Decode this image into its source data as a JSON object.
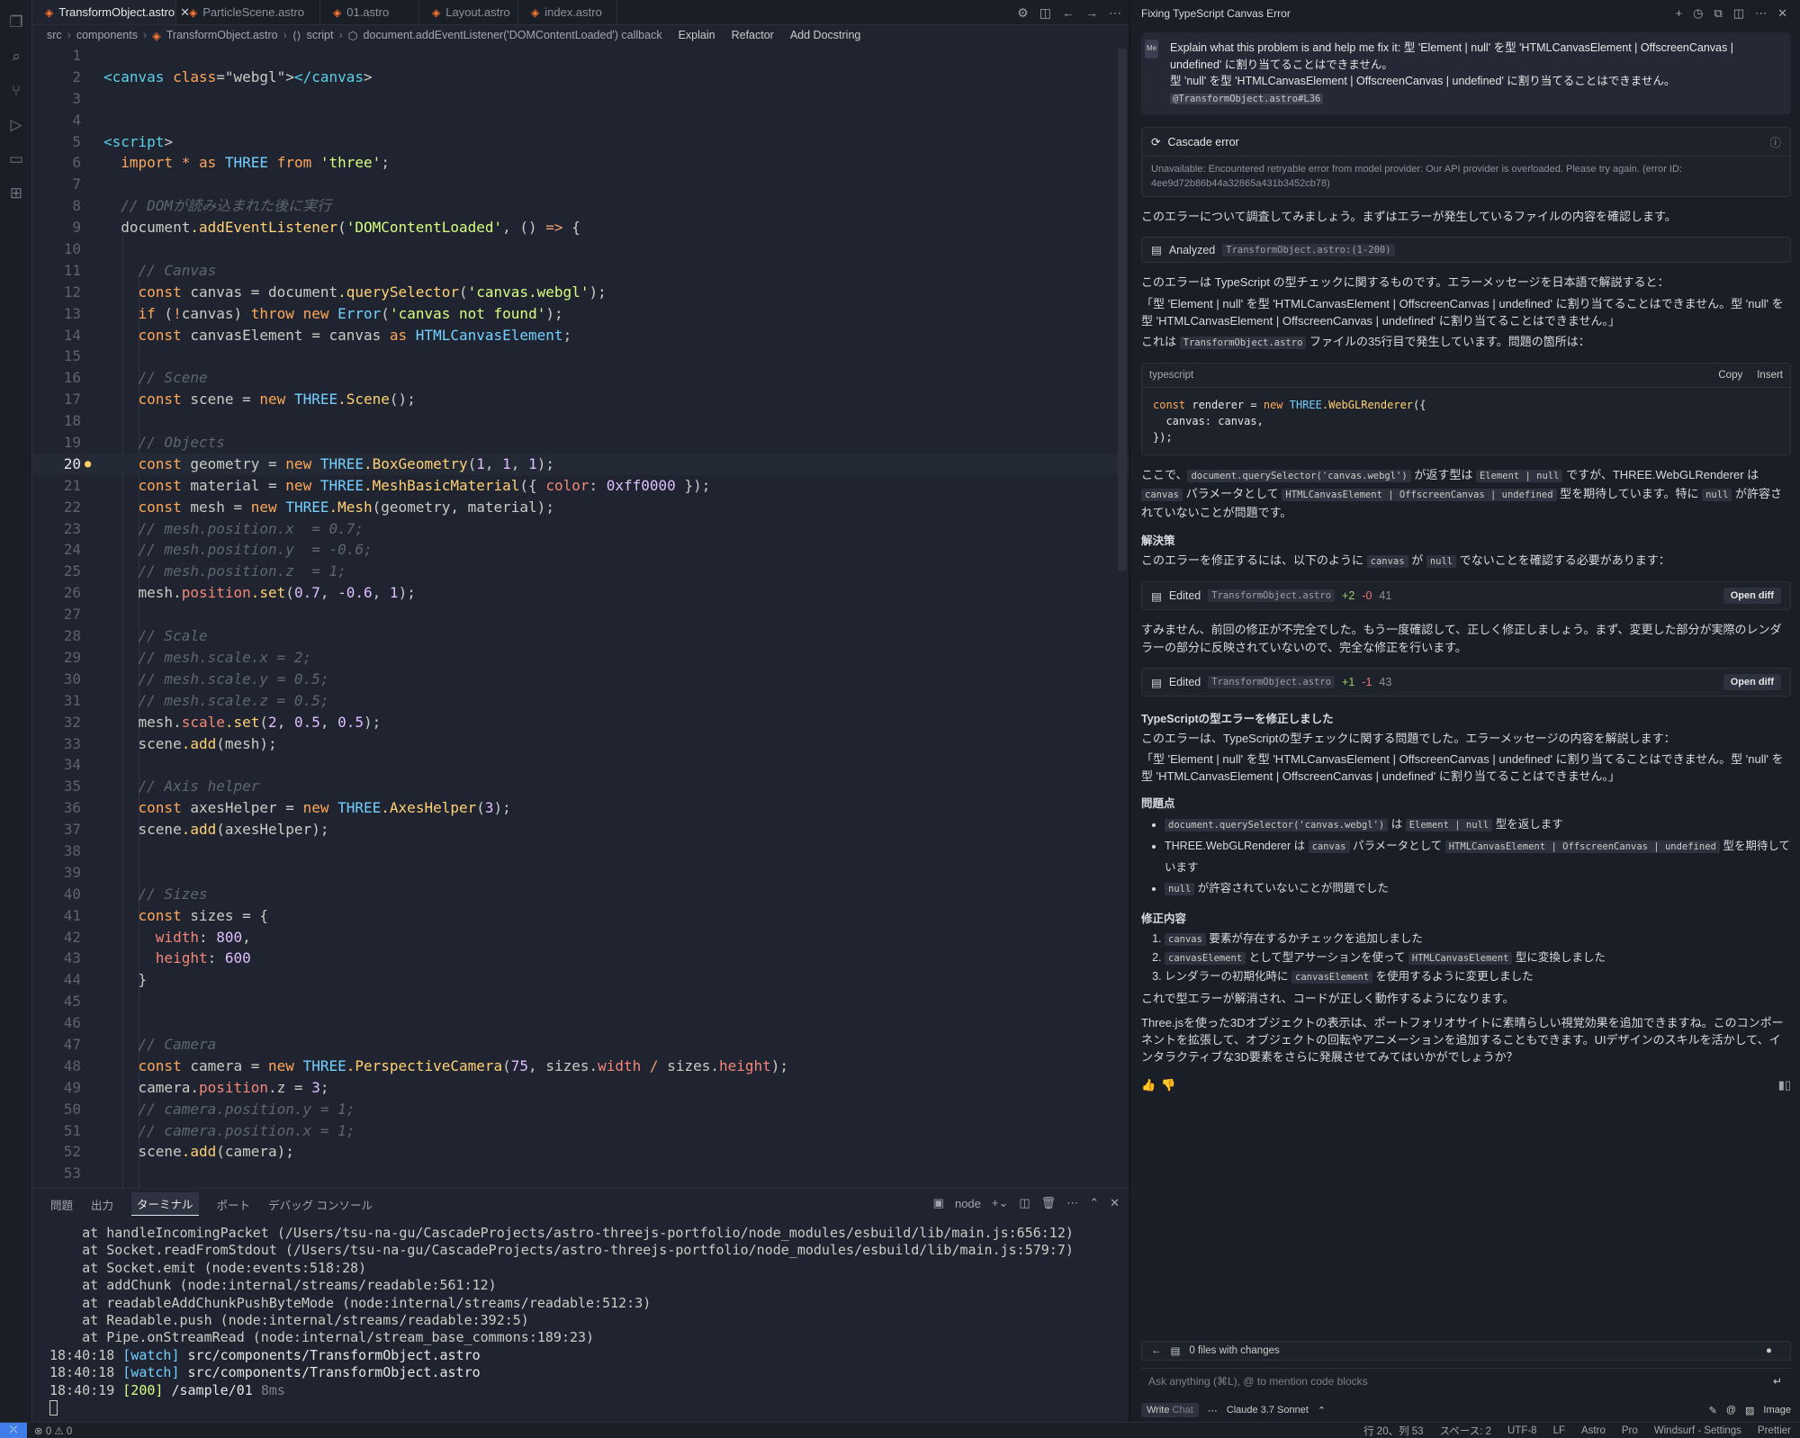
{
  "tabs": [
    {
      "label": "TransformObject.astro",
      "active": true
    },
    {
      "label": "ParticleScene.astro"
    },
    {
      "label": "01.astro"
    },
    {
      "label": "Layout.astro"
    },
    {
      "label": "index.astro"
    }
  ],
  "breadcrumb": [
    "src",
    "components",
    "TransformObject.astro",
    "script",
    "document.addEventListener('DOMContentLoaded') callback"
  ],
  "code_actions": [
    "Explain",
    "Refactor",
    "Add Docstring"
  ],
  "code_lines": [
    {
      "n": "1",
      "t": ""
    },
    {
      "n": "2",
      "t": "<canvas class=\"webgl\"></canvas>"
    },
    {
      "n": "3",
      "t": ""
    },
    {
      "n": "4",
      "t": ""
    },
    {
      "n": "5",
      "t": "<script>"
    },
    {
      "n": "6",
      "t": "  import * as THREE from 'three';"
    },
    {
      "n": "7",
      "t": ""
    },
    {
      "n": "8",
      "t": "  // DOMが読み込まれた後に実行"
    },
    {
      "n": "9",
      "t": "  document.addEventListener('DOMContentLoaded', () => {"
    },
    {
      "n": "10",
      "t": ""
    },
    {
      "n": "11",
      "t": "    // Canvas"
    },
    {
      "n": "12",
      "t": "    const canvas = document.querySelector('canvas.webgl');"
    },
    {
      "n": "13",
      "t": "    if (!canvas) throw new Error('canvas not found');"
    },
    {
      "n": "14",
      "t": "    const canvasElement = canvas as HTMLCanvasElement;"
    },
    {
      "n": "15",
      "t": ""
    },
    {
      "n": "16",
      "t": "    // Scene"
    },
    {
      "n": "17",
      "t": "    const scene = new THREE.Scene();"
    },
    {
      "n": "18",
      "t": ""
    },
    {
      "n": "19",
      "t": "    // Objects"
    },
    {
      "n": "20",
      "t": "    const geometry = new THREE.BoxGeometry(1, 1, 1);"
    },
    {
      "n": "21",
      "t": "    const material = new THREE.MeshBasicMaterial({ color: 0xff0000 });"
    },
    {
      "n": "22",
      "t": "    const mesh = new THREE.Mesh(geometry, material);"
    },
    {
      "n": "23",
      "t": "    // mesh.position.x  = 0.7;"
    },
    {
      "n": "24",
      "t": "    // mesh.position.y  = -0.6;"
    },
    {
      "n": "25",
      "t": "    // mesh.position.z  = 1;"
    },
    {
      "n": "26",
      "t": "    mesh.position.set(0.7, -0.6, 1);"
    },
    {
      "n": "27",
      "t": ""
    },
    {
      "n": "28",
      "t": "    // Scale"
    },
    {
      "n": "29",
      "t": "    // mesh.scale.x = 2;"
    },
    {
      "n": "30",
      "t": "    // mesh.scale.y = 0.5;"
    },
    {
      "n": "31",
      "t": "    // mesh.scale.z = 0.5;"
    },
    {
      "n": "32",
      "t": "    mesh.scale.set(2, 0.5, 0.5);"
    },
    {
      "n": "33",
      "t": "    scene.add(mesh);"
    },
    {
      "n": "34",
      "t": ""
    },
    {
      "n": "35",
      "t": "    // Axis helper"
    },
    {
      "n": "36",
      "t": "    const axesHelper = new THREE.AxesHelper(3);"
    },
    {
      "n": "37",
      "t": "    scene.add(axesHelper);"
    },
    {
      "n": "38",
      "t": ""
    },
    {
      "n": "39",
      "t": ""
    },
    {
      "n": "40",
      "t": "    // Sizes"
    },
    {
      "n": "41",
      "t": "    const sizes = {"
    },
    {
      "n": "42",
      "t": "      width: 800,"
    },
    {
      "n": "43",
      "t": "      height: 600"
    },
    {
      "n": "44",
      "t": "    }"
    },
    {
      "n": "45",
      "t": ""
    },
    {
      "n": "46",
      "t": ""
    },
    {
      "n": "47",
      "t": "    // Camera"
    },
    {
      "n": "48",
      "t": "    const camera = new THREE.PerspectiveCamera(75, sizes.width / sizes.height);"
    },
    {
      "n": "49",
      "t": "    camera.position.z = 3;"
    },
    {
      "n": "50",
      "t": "    // camera.position.y = 1;"
    },
    {
      "n": "51",
      "t": "    // camera.position.x = 1;"
    },
    {
      "n": "52",
      "t": "    scene.add(camera);"
    },
    {
      "n": "53",
      "t": ""
    }
  ],
  "current_line": "20",
  "panel": {
    "tabs": [
      "問題",
      "出力",
      "ターミナル",
      "ポート",
      "デバッグ コンソール"
    ],
    "active_tab": "ターミナル",
    "shell": "node",
    "terminal_lines": [
      "    at handleIncomingPacket (/Users/tsu-na-gu/CascadeProjects/astro-threejs-portfolio/node_modules/esbuild/lib/main.js:656:12)",
      "    at Socket.readFromStdout (/Users/tsu-na-gu/CascadeProjects/astro-threejs-portfolio/node_modules/esbuild/lib/main.js:579:7)",
      "    at Socket.emit (node:events:518:28)",
      "    at addChunk (node:internal/streams/readable:561:12)",
      "    at readableAddChunkPushByteMode (node:internal/streams/readable:512:3)",
      "    at Readable.push (node:internal/streams/readable:392:5)",
      "    at Pipe.onStreamRead (node:internal/stream_base_commons:189:23)"
    ],
    "log_lines": [
      {
        "time": "18:40:18",
        "tag": "[watch]",
        "msg": "src/components/TransformObject.astro"
      },
      {
        "time": "18:40:18",
        "tag": "[watch]",
        "msg": "src/components/TransformObject.astro"
      },
      {
        "time": "18:40:19",
        "tag": "[200]",
        "msg": "/sample/01",
        "extra": "8ms"
      }
    ]
  },
  "chat": {
    "title": "Fixing TypeScript Canvas Error",
    "user_avatar": "Me",
    "user_message": "Explain what this problem is and help me fix it: 型 'Element | null' を型 'HTMLCanvasElement | OffscreenCanvas | undefined' に割り当てることはできません。",
    "user_message_2": "型 'null' を型 'HTMLCanvasElement | OffscreenCanvas | undefined' に割り当てることはできません。",
    "user_mention": "@TransformObject.astro#L36",
    "error_title": "Cascade error",
    "error_body": "Unavailable: Encountered retryable error from model provider: Our API provider is overloaded. Please try again. (error ID: 4ee9d72b86b44a32865a431b3452cb78)",
    "p1": "このエラーについて調査してみましょう。まずはエラーが発生しているファイルの内容を確認します。",
    "analyzed_label": "Analyzed",
    "analyzed_file": "TransformObject.astro:(1-200)",
    "p2": "このエラーは TypeScript の型チェックに関するものです。エラーメッセージを日本語で解説すると：",
    "p3": "「型 'Element | null' を型 'HTMLCanvasElement | OffscreenCanvas | undefined' に割り当てることはできません。型 'null' を型 'HTMLCanvasElement | OffscreenCanvas | undefined' に割り当てることはできません。」",
    "p4a": "これは",
    "p4file": "TransformObject.astro",
    "p4b": "ファイルの35行目で発生しています。問題の箇所は：",
    "codeblock": {
      "lang": "typescript",
      "copy": "Copy",
      "insert": "Insert",
      "code": "const renderer = new THREE.WebGLRenderer({\n  canvas: canvas,\n});"
    },
    "p5a": "ここで、",
    "p5c1": "document.querySelector('canvas.webgl')",
    "p5b": "が返す型は",
    "p5c2": "Element | null",
    "p5c": "ですが、THREE.WebGLRenderer は",
    "p5c3": "canvas",
    "p5d": "パラメータとして",
    "p5c4": "HTMLCanvasElement | OffscreenCanvas | undefined",
    "p5e": "型を期待しています。特に",
    "p5c5": "null",
    "p5f": "が許容されていないことが問題です。",
    "h_solution": "解決策",
    "p6a": "このエラーを修正するには、以下のように",
    "p6c1": "canvas",
    "p6b": "が",
    "p6c2": "null",
    "p6c": "でないことを確認する必要があります：",
    "edit1": {
      "label": "Edited",
      "file": "TransformObject.astro",
      "add": "+2",
      "del": "-0",
      "line": "41",
      "btn": "Open diff"
    },
    "p7": "すみません、前回の修正が不完全でした。もう一度確認して、正しく修正しましょう。まず、変更した部分が実際のレンダラーの部分に反映されていないので、完全な修正を行います。",
    "edit2": {
      "label": "Edited",
      "file": "TransformObject.astro",
      "add": "+1",
      "del": "-1",
      "line": "43",
      "btn": "Open diff"
    },
    "h_fixed": "TypeScriptの型エラーを修正しました",
    "p8": "このエラーは、TypeScriptの型チェックに関する問題でした。エラーメッセージの内容を解説します：",
    "p9": "「型 'Element | null' を型 'HTMLCanvasElement | OffscreenCanvas | undefined' に割り当てることはできません。型 'null' を型 'HTMLCanvasElement | OffscreenCanvas | undefined' に割り当てることはできません。」",
    "h_problem": "問題点",
    "b1c1": "document.querySelector('canvas.webgl')",
    "b1a": "は",
    "b1c2": "Element | null",
    "b1b": "型を返します",
    "b2a": "THREE.WebGLRenderer は",
    "b2c1": "canvas",
    "b2b": "パラメータとして",
    "b2c2": "HTMLCanvasElement | OffscreenCanvas | undefined",
    "b2c": "型を期待しています",
    "b3c1": "null",
    "b3a": "が許容されていないことが問題でした",
    "h_fix": "修正内容",
    "n1c": "canvas",
    "n1": "要素が存在するかチェックを追加しました",
    "n2c1": "canvasElement",
    "n2a": "として型アサーションを使って",
    "n2c2": "HTMLCanvasElement",
    "n2b": "型に変換しました",
    "n3a": "レンダラーの初期化時に",
    "n3c": "canvasElement",
    "n3b": "を使用するように変更しました",
    "p10": "これで型エラーが解消され、コードが正しく動作するようになります。",
    "p11": "Three.jsを使った3Dオブジェクトの表示は、ポートフォリオサイトに素晴らしい視覚効果を追加できますね。このコンポーネントを拡張して、オブジェクトの回転やアニメーションを追加することもできます。UIデザインのスキルを活かして、インタラクティブな3D要素をさらに発展させてみてはいかがでしょうか？",
    "files_changes": "0 files with changes",
    "input_placeholder": "Ask anything (⌘L), @ to mention code blocks",
    "mode_write": "Write",
    "mode_chat": "Chat",
    "model": "Claude 3.7 Sonnet",
    "image_label": "Image"
  },
  "status": {
    "problems": "⊗ 0  ⚠ 0",
    "items": [
      "行 20、列 53",
      "スペース: 2",
      "UTF-8",
      "LF",
      "Astro",
      "Pro",
      "Windsurf - Settings",
      "Prettier"
    ]
  },
  "colors": {
    "accent": "#3f7de8",
    "bg": "#1f2430",
    "keyword": "#ffa759",
    "string": "#d5ff80"
  }
}
